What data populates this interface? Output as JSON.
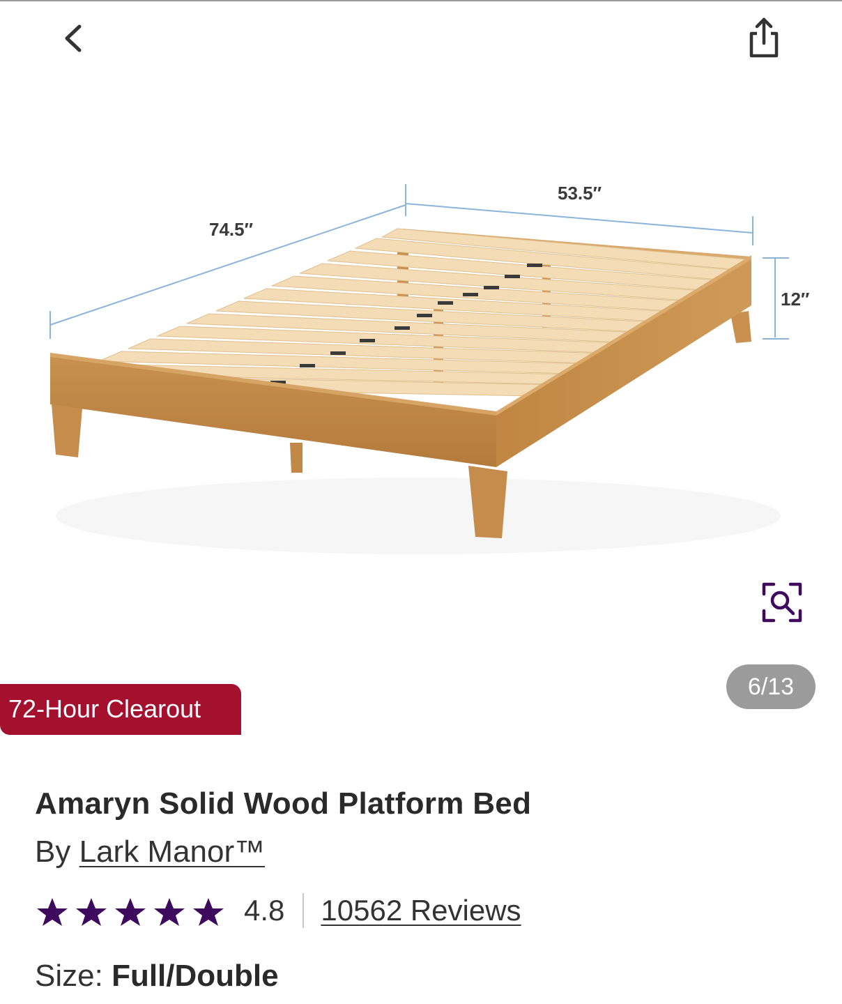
{
  "header": {
    "back_icon": "chevron-left-icon",
    "share_icon": "share-icon"
  },
  "gallery": {
    "dimensions": {
      "length": "74.5″",
      "width": "53.5″",
      "height": "12″"
    },
    "zoom_icon": "zoom-icon",
    "counter": "6/13",
    "promo_badge": "72-Hour Clearout"
  },
  "product": {
    "title": "Amaryn Solid Wood Platform Bed",
    "by_label": "By",
    "brand": "Lark Manor™",
    "rating_value": "4.8",
    "star_count": 5,
    "review_count": "10562 Reviews",
    "size_label": "Size:",
    "size_value": "Full/Double"
  },
  "colors": {
    "promo": "#a3112e",
    "star": "#3d0a5e",
    "counter_bg": "#9b9b9b",
    "dimension_line": "#8ab4dc",
    "wood": "#c98f4e",
    "slat": "#f4dcb6"
  }
}
